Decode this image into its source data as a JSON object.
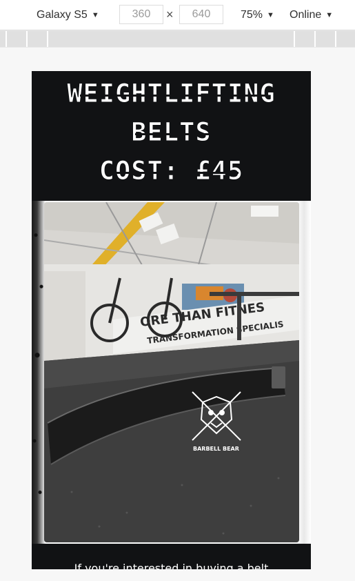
{
  "devtools": {
    "device": "Galaxy S5",
    "width": "360",
    "height": "640",
    "times_symbol": "×",
    "zoom": "75%",
    "network": "Online"
  },
  "page": {
    "title_line1": "WEIGHTLIFTING",
    "title_line2": "BELTS",
    "title_line3": "COST: £45",
    "photo_text_logo": "BARBELL BEAR",
    "photo_banner_text_1": "ORE THAN FITNES",
    "photo_banner_text_2": "TRANSFORMATION SPECIALIS",
    "cta_text": "If you're interested in buying a belt"
  },
  "colors": {
    "page_background": "#111214",
    "title_color": "#ffffff",
    "canvas_background": "#f7f7f7"
  },
  "icons": {
    "dropdown": "caret-down-icon"
  }
}
